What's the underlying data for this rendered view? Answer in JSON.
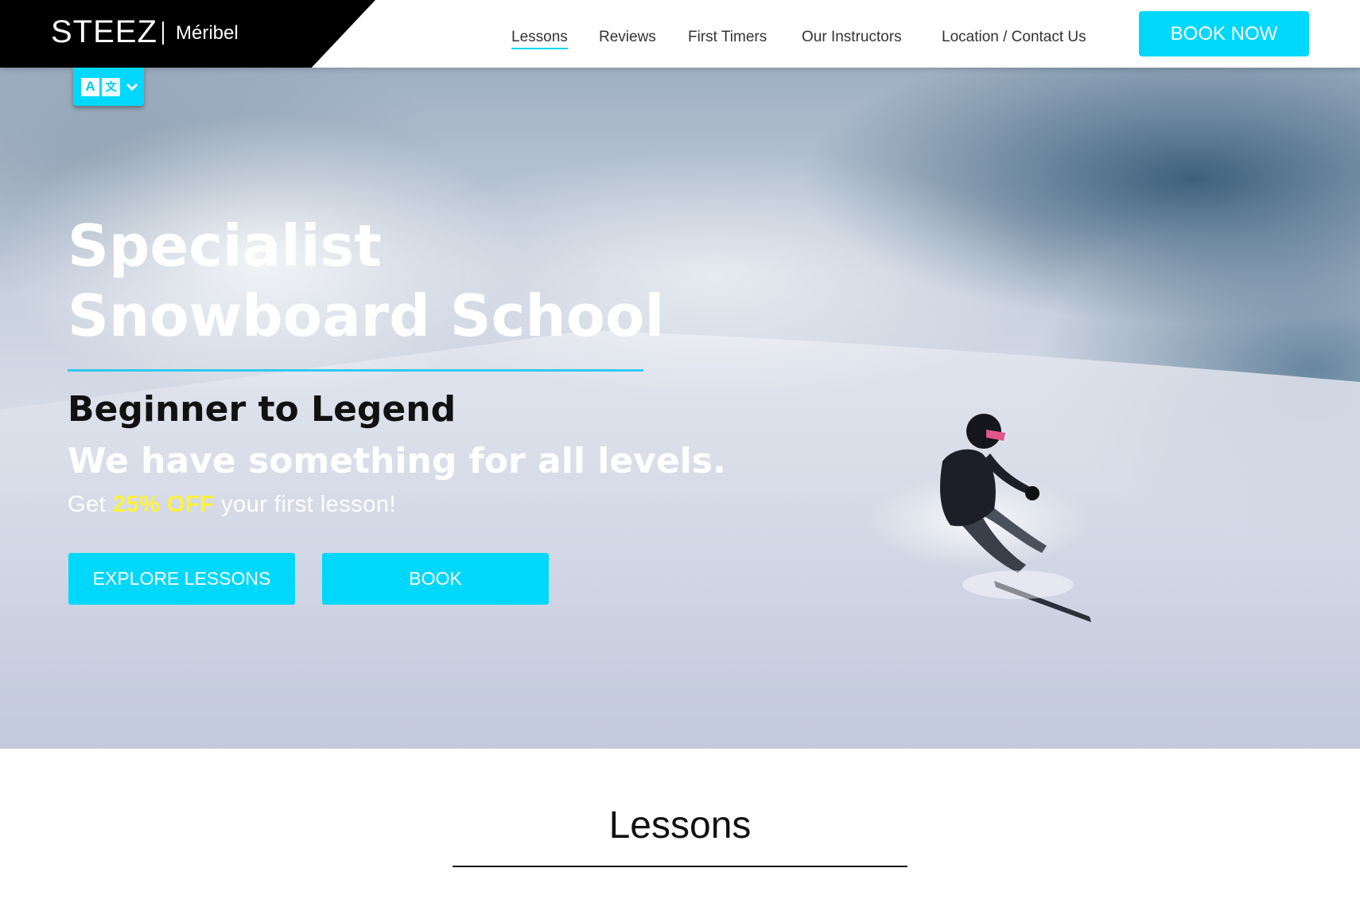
{
  "header": {
    "brand": "STEEZ",
    "location": "Méribel",
    "nav": [
      {
        "label": "Lessons",
        "active": true
      },
      {
        "label": "Reviews",
        "active": false
      },
      {
        "label": "First Timers",
        "active": false
      },
      {
        "label": "Our Instructors",
        "active": false
      },
      {
        "label": "Location / Contact Us",
        "active": false
      }
    ],
    "book_now": "BOOK NOW"
  },
  "language": {
    "icon": "translate-icon",
    "glyph_a": "A",
    "glyph_b": "文",
    "chevron": "chevron-down-icon"
  },
  "hero": {
    "title_line1": "Specialist",
    "title_line2": "Snowboard School",
    "subtitle": "Beginner to Legend",
    "tagline": "We have something for all levels.",
    "offer_prefix": "Get ",
    "offer_highlight": "25% OFF",
    "offer_suffix": " your first lesson!",
    "explore_button": "EXPLORE LESSONS",
    "book_button": "BOOK"
  },
  "lessons": {
    "heading": "Lessons"
  },
  "colors": {
    "accent": "#00d8fb",
    "highlight": "#fff23a",
    "logo_bg": "#000000"
  }
}
